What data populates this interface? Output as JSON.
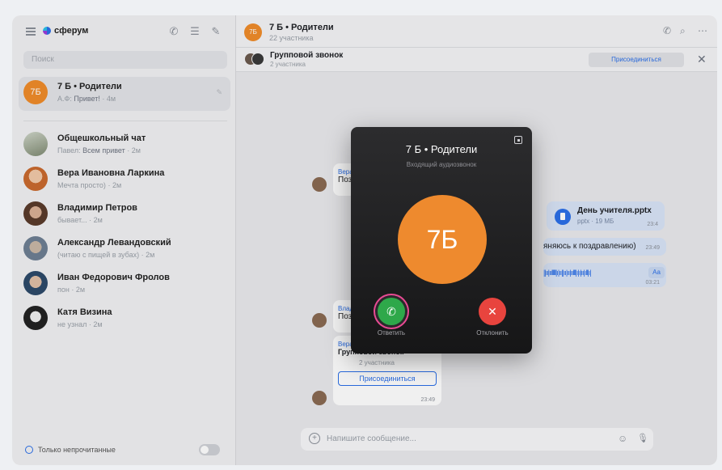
{
  "sidebar": {
    "logo": "сферум",
    "search_placeholder": "Поиск",
    "chats": [
      {
        "name": "7 Б • Родители",
        "avatar_text": "7Б",
        "author": "А.Ф:",
        "preview": "Привет!",
        "time": "4м"
      },
      {
        "name": "Общешкольный чат",
        "author": "Павел:",
        "preview": "Всем привет",
        "time": "2м"
      },
      {
        "name": "Вера Ивановна Ларкина",
        "preview": "Мечта просто)",
        "time": "2м"
      },
      {
        "name": "Владимир Петров",
        "preview": "бывает...",
        "time": "2м"
      },
      {
        "name": "Александр Левандовский",
        "preview": "(читаю с пищей в зубах)",
        "time": "2м"
      },
      {
        "name": "Иван Федорович Фролов",
        "preview": "пон",
        "time": "2м"
      },
      {
        "name": "Катя Визина",
        "preview": "не узнал",
        "time": "2м"
      }
    ],
    "unread_only_label": "Только непрочитанные"
  },
  "header": {
    "avatar_text": "7Б",
    "title": "7 Б • Родители",
    "subtitle": "22 участника"
  },
  "call_bar": {
    "title": "Групповой звонок",
    "subtitle": "2 участника",
    "join_label": "Присоединиться"
  },
  "messages": {
    "m1_author": "Вера И",
    "m1_text": "Поздр",
    "file_name": "День учителя.pptx",
    "file_meta": "pptx · 19 МБ",
    "file_time": "23:4",
    "reply_text": "яняюсь к поздравлению)",
    "reply_time": "23:49",
    "voice_wave": "||ıı|ıılllll|ı|ıı||ıı|ıı|ıılll|ı|ı|ıı|ıll|ı|",
    "voice_aa": "Аа",
    "voice_time": "03:21",
    "m2_author": "Владим",
    "m2_text": "Поздр",
    "m3_author": "Вера И",
    "m3_text": "Групповой звонок",
    "m3_participants": "2 участника",
    "m3_join": "Присоединиться",
    "m3_time": "23:49"
  },
  "input": {
    "placeholder": "Напишите сообщение..."
  },
  "call_modal": {
    "title": "7 Б • Родители",
    "subtitle": "Входящий аудиозвонок",
    "avatar_text": "7Б",
    "accept_label": "Ответить",
    "decline_label": "Отклонить"
  },
  "colors": {
    "accent": "#2b6fe8",
    "avatar_orange": "#ee8a2e",
    "accept": "#2ea84a",
    "decline": "#e8443e",
    "highlight": "#e84a93"
  }
}
